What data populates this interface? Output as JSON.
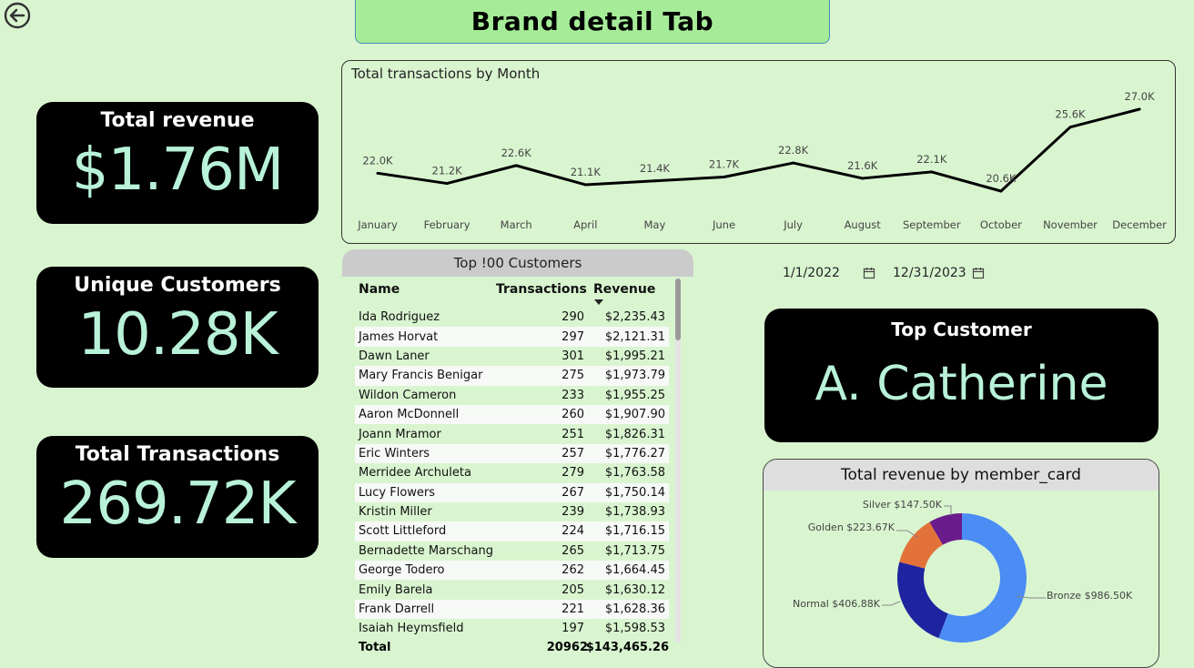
{
  "header": {
    "title": "Brand detail Tab"
  },
  "kpis": {
    "revenue": {
      "label": "Total revenue",
      "value": "$1.76M"
    },
    "customers": {
      "label": "Unique Customers",
      "value": "10.28K"
    },
    "transactions": {
      "label": "Total Transactions",
      "value": "269.72K"
    }
  },
  "date_range": {
    "start": "1/1/2022",
    "end": "12/31/2023"
  },
  "top_customer": {
    "label": "Top Customer",
    "value": "A. Catherine"
  },
  "table": {
    "title": "Top !00 Customers",
    "columns": [
      "Name",
      "Transactions",
      "Revenue"
    ],
    "rows": [
      [
        "Ida Rodriguez",
        "290",
        "$2,235.43"
      ],
      [
        "James Horvat",
        "297",
        "$2,121.31"
      ],
      [
        "Dawn Laner",
        "301",
        "$1,995.21"
      ],
      [
        "Mary Francis Benigar",
        "275",
        "$1,973.79"
      ],
      [
        "Wildon Cameron",
        "233",
        "$1,955.25"
      ],
      [
        "Aaron McDonnell",
        "260",
        "$1,907.90"
      ],
      [
        "Joann Mramor",
        "251",
        "$1,826.31"
      ],
      [
        "Eric Winters",
        "257",
        "$1,776.27"
      ],
      [
        "Merridee Archuleta",
        "279",
        "$1,763.58"
      ],
      [
        "Lucy Flowers",
        "267",
        "$1,750.14"
      ],
      [
        "Kristin Miller",
        "239",
        "$1,738.93"
      ],
      [
        "Scott Littleford",
        "224",
        "$1,716.15"
      ],
      [
        "Bernadette Marschang",
        "265",
        "$1,713.75"
      ],
      [
        "George Todero",
        "262",
        "$1,664.45"
      ],
      [
        "Emily Barela",
        "205",
        "$1,630.12"
      ],
      [
        "Frank Darrell",
        "221",
        "$1,628.36"
      ],
      [
        "Isaiah Heymsfield",
        "197",
        "$1,598.53"
      ]
    ],
    "total": {
      "label": "Total",
      "transactions": "20962",
      "revenue": "$143,465.26"
    }
  },
  "chart_data": [
    {
      "type": "line",
      "title": "Total transactions by Month",
      "categories": [
        "January",
        "February",
        "March",
        "April",
        "May",
        "June",
        "July",
        "August",
        "September",
        "October",
        "November",
        "December"
      ],
      "values": [
        22.0,
        21.2,
        22.6,
        21.1,
        21.4,
        21.7,
        22.8,
        21.6,
        22.1,
        20.6,
        25.6,
        27.0
      ],
      "data_labels": [
        "22.0K",
        "21.2K",
        "22.6K",
        "21.1K",
        "21.4K",
        "21.7K",
        "22.8K",
        "21.6K",
        "22.1K",
        "20.6K",
        "25.6K",
        "27.0K"
      ],
      "grid": false
    },
    {
      "type": "pie",
      "title": "Total revenue by member_card",
      "slices": [
        {
          "name": "Bronze",
          "value": 986.5,
          "label": "Bronze $986.50K",
          "color": "#4b8cf5"
        },
        {
          "name": "Normal",
          "value": 406.88,
          "label": "Normal $406.88K",
          "color": "#1e23a0"
        },
        {
          "name": "Golden",
          "value": 223.67,
          "label": "Golden $223.67K",
          "color": "#e2723a"
        },
        {
          "name": "Silver",
          "value": 147.5,
          "label": "Silver $147.50K",
          "color": "#6a1b8c"
        }
      ]
    }
  ],
  "colors": {
    "background": "#d9f5d0",
    "kpi_value": "#b8f2d8",
    "title_bg": "#a6ec98"
  }
}
